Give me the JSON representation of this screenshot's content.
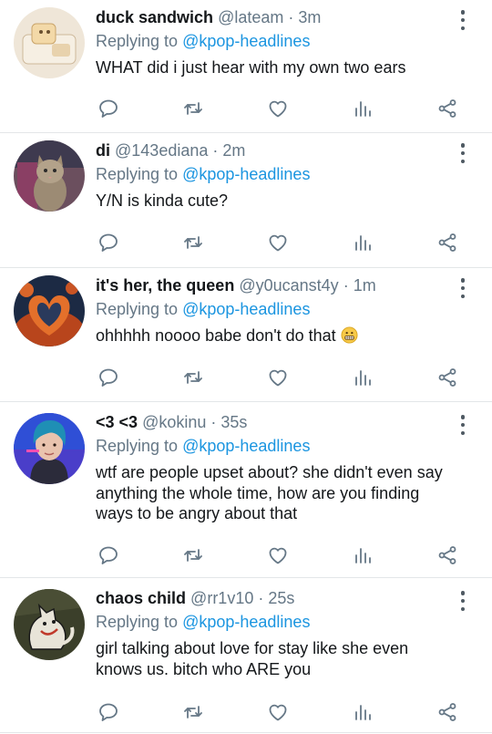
{
  "tweets": [
    {
      "name": "duck sandwich",
      "handle": "@lateam",
      "time": "3m",
      "reply_prefix": "Replying to",
      "reply_to": "@kpop-headlines",
      "text": "WHAT did i just hear with my own two ears",
      "avatar": "duck-sandwich-avatar"
    },
    {
      "name": "di",
      "handle": "@143ediana",
      "time": "2m",
      "reply_prefix": "Replying to",
      "reply_to": "@kpop-headlines",
      "text": "Y/N is kinda cute?",
      "avatar": "cat-avatar"
    },
    {
      "name": "it's her, the queen",
      "handle": "@y0ucanst4y",
      "time": "1m",
      "reply_prefix": "Replying to",
      "reply_to": "@kpop-headlines",
      "text": "ohhhhh noooo babe don't do that",
      "emoji": "grimacing-face",
      "avatar": "fire-heart-avatar"
    },
    {
      "name": "<3 <3",
      "handle": "@kokinu",
      "time": "35s",
      "reply_prefix": "Replying to",
      "reply_to": "@kpop-headlines",
      "text": "wtf are people upset about? she didn't even say anything the whole time, how are you finding ways to be angry about that",
      "avatar": "singer-avatar"
    },
    {
      "name": "chaos child",
      "handle": "@rr1v10",
      "time": "25s",
      "reply_prefix": "Replying to",
      "reply_to": "@kpop-headlines",
      "text": "girl talking about love for stay like she even knows us. bitch who ARE you",
      "avatar": "cat-drawing-avatar"
    }
  ],
  "separator": "·",
  "colors": {
    "mention": "#1b95e0",
    "secondary": "#657786",
    "divider": "#e3e6e8"
  },
  "action_icons": [
    "reply-icon",
    "retweet-icon",
    "like-icon",
    "stats-icon",
    "share-icon"
  ]
}
